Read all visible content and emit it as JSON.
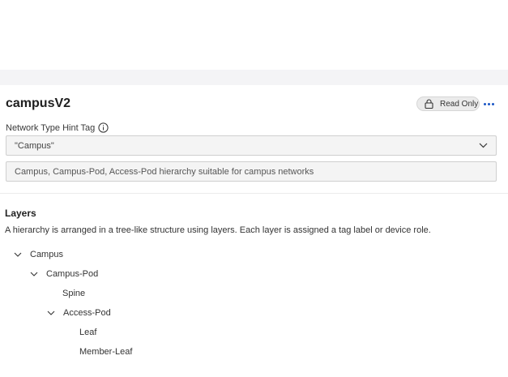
{
  "header": {
    "title": "campusV2",
    "read_only_label": "Read Only"
  },
  "network_type": {
    "label": "Network Type Hint Tag",
    "selected_value": "\"Campus\"",
    "description": "Campus, Campus-Pod, Access-Pod hierarchy suitable for campus networks"
  },
  "layers": {
    "title": "Layers",
    "description": "A hierarchy is arranged in a tree-like structure using layers. Each layer is assigned a tag label or device role.",
    "tree": [
      {
        "label": "Campus",
        "expanded": true
      },
      {
        "label": "Campus-Pod",
        "expanded": true
      },
      {
        "label": "Spine"
      },
      {
        "label": "Access-Pod",
        "expanded": true
      },
      {
        "label": "Leaf"
      },
      {
        "label": "Member-Leaf"
      }
    ]
  },
  "icons": {
    "lock": "lock-icon",
    "info": "info-icon",
    "chevron": "chevron-down-icon",
    "more": "more-horizontal-icon"
  },
  "colors": {
    "accent": "#1a56c5",
    "band": "#f4f4f6",
    "field_bg": "#f4f4f4"
  }
}
